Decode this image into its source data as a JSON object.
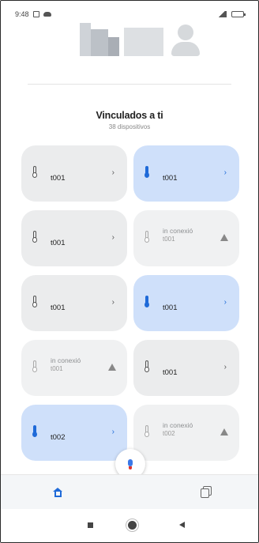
{
  "status_bar": {
    "time": "9:48"
  },
  "header": {
    "caption": ""
  },
  "section": {
    "title": "Vinculados a ti",
    "subtitle": "38 dispositivos"
  },
  "devices": [
    {
      "label": "t001",
      "top_text": "",
      "state": "normal"
    },
    {
      "label": "t001",
      "top_text": "",
      "state": "active"
    },
    {
      "label": "t001",
      "top_text": "",
      "state": "normal"
    },
    {
      "label": "t001",
      "top_text": "in conexió",
      "state": "offline"
    },
    {
      "label": "t001",
      "top_text": "",
      "state": "normal"
    },
    {
      "label": "t001",
      "top_text": "",
      "state": "active"
    },
    {
      "label": "t001",
      "top_text": "in conexió",
      "state": "offline"
    },
    {
      "label": "t001",
      "top_text": "",
      "state": "normal"
    },
    {
      "label": "t002",
      "top_text": "",
      "state": "active"
    },
    {
      "label": "t002",
      "top_text": "in conexió",
      "state": "offline"
    }
  ],
  "icons": {
    "device": "thermometer-icon",
    "open": "chevron-right-icon",
    "warning": "warning-icon",
    "mic": "mic-icon",
    "home": "home-icon",
    "docs": "documents-icon"
  },
  "colors": {
    "accent": "#1f6ad8",
    "active_card": "#cfe0fa",
    "card": "#ebeced"
  }
}
